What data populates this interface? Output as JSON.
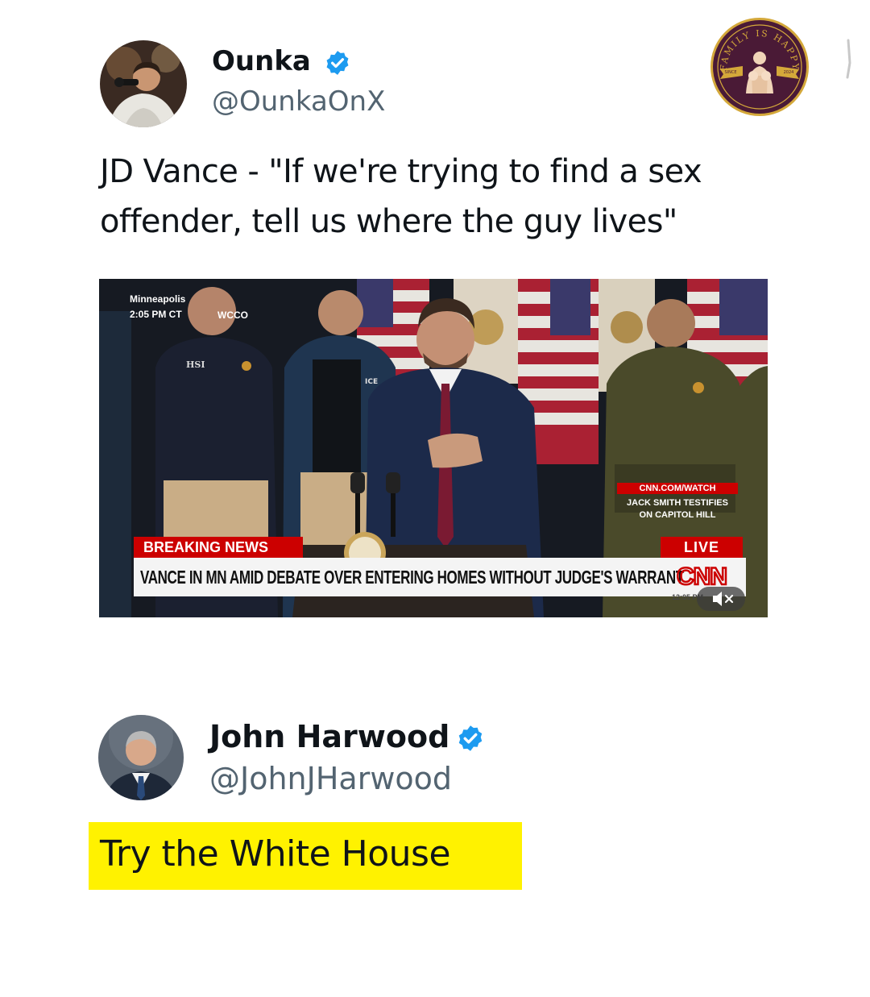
{
  "tweet1": {
    "display_name": "Ounka",
    "handle": "@OunkaOnX",
    "verified_icon": "verified-badge-icon",
    "text_line1": "JD Vance - \"If we're trying to find a sex",
    "text_line2": "offender, tell us where the guy lives\"",
    "video": {
      "location": "Minneapolis",
      "time": "2:05 PM CT",
      "station": "WCCO",
      "jacket_left": "HSI",
      "jacket_right": "ICE",
      "promo_url": "CNN.COM/WATCH",
      "promo_line1": "JACK SMITH TESTIFIES",
      "promo_line2": "ON CAPITOL HILL",
      "breaking_label": "BREAKING NEWS",
      "live_label": "LIVE",
      "headline": "VANCE IN MN AMID DEBATE OVER ENTERING HOMES WITHOUT JUDGE'S WARRANT",
      "network_logo": "CNN",
      "timecode": "12:05 PM",
      "mute_icon": "muted-speaker-icon"
    }
  },
  "tweet2": {
    "display_name": "John Harwood",
    "handle": "@JohnJHarwood",
    "verified_icon": "verified-badge-icon",
    "text": "Try the White House"
  },
  "watermark": {
    "arc_text": "FAMILY IS HAPPY",
    "left_ribbon": "SINCE",
    "right_ribbon": "2024"
  },
  "colors": {
    "verified_blue": "#1d9bf0",
    "handle_gray": "#536471",
    "highlight_yellow": "#fff200",
    "cnn_red": "#cc0000",
    "watermark_maroon": "#4a1a36",
    "watermark_gold": "#d4a83a"
  }
}
